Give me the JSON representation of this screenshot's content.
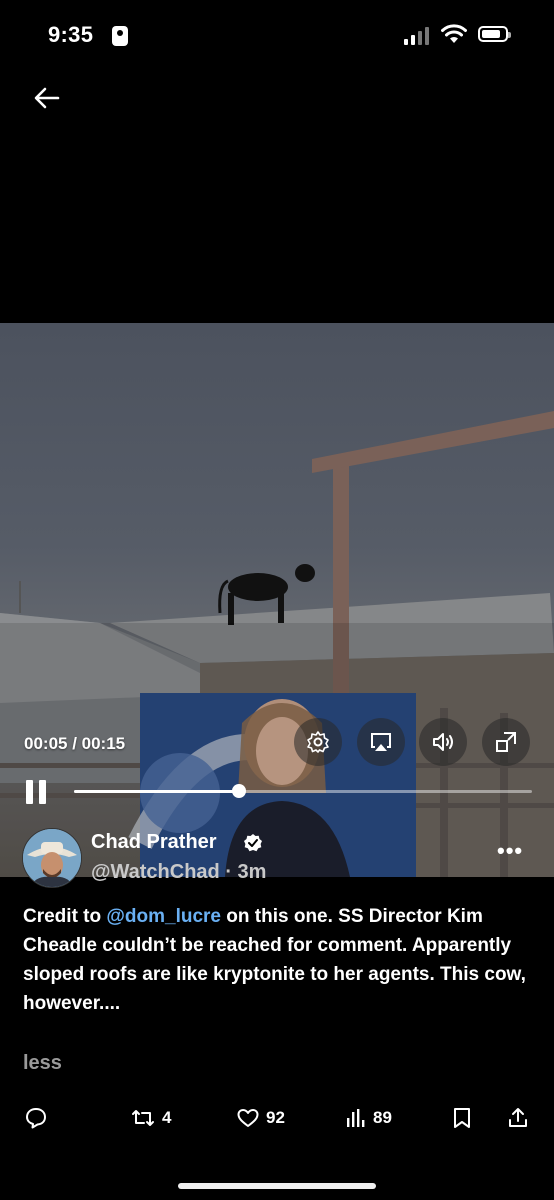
{
  "status_bar": {
    "time": "9:35"
  },
  "video": {
    "current_time": "00:05",
    "duration": "00:15",
    "timecode": "00:05 / 00:15",
    "progress_fraction": 0.36
  },
  "author": {
    "name": "Chad Prather",
    "handle": "@WatchChad",
    "age": "3m",
    "handle_line": "@WatchChad · 3m"
  },
  "tweet": {
    "prefix": "Credit to ",
    "mention": "@dom_lucre",
    "body": " on this one. SS Director Kim Cheadle couldn’t be reached for comment. Apparently sloped roofs are like kryptonite to her agents.  This cow, however....",
    "less_label": "less"
  },
  "actions": {
    "retweets": "4",
    "likes": "92",
    "views": "89"
  },
  "colors": {
    "accent": "#6ab0f3",
    "background": "#000000"
  }
}
